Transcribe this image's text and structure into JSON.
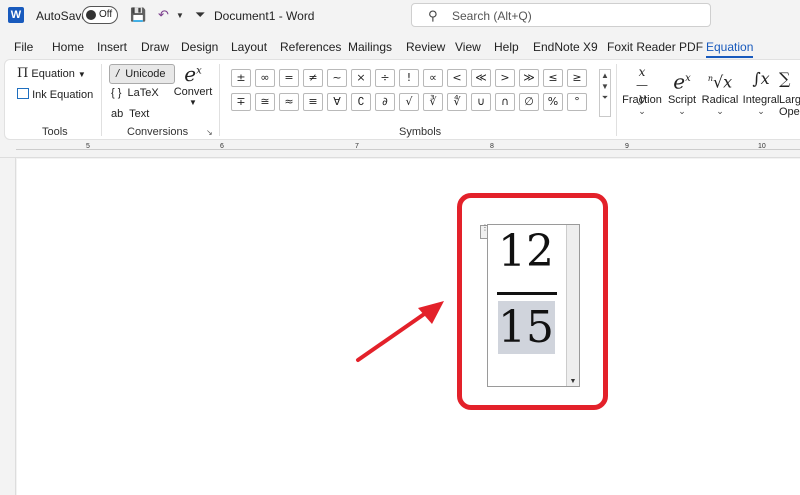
{
  "titlebar": {
    "word_badge": "W",
    "autosave_label": "AutoSave",
    "autosave_state": "Off",
    "doc_title": "Document1  -  Word",
    "search_placeholder": "Search (Alt+Q)"
  },
  "tabs": [
    "File",
    "Home",
    "Insert",
    "Draw",
    "Design",
    "Layout",
    "References",
    "Mailings",
    "Review",
    "View",
    "Help",
    "EndNote X9",
    "Foxit Reader PDF",
    "Equation"
  ],
  "active_tab": "Equation",
  "ribbon": {
    "tools": {
      "equation_label": "Equation",
      "ink_label": "Ink Equation",
      "group_label": "Tools"
    },
    "conversions": {
      "unicode_label": "Unicode",
      "latex_label": "LaTeX",
      "text_label": "Text",
      "convert_label": "Convert",
      "group_label": "Conversions"
    },
    "symbols": {
      "row1": [
        "±",
        "∞",
        "=",
        "≠",
        "~",
        "×",
        "÷",
        "!",
        "∝",
        "<",
        "≪",
        ">",
        "≫",
        "≤",
        "≥"
      ],
      "row2": [
        "∓",
        "≅",
        "≈",
        "≡",
        "∀",
        "∁",
        "∂",
        "√",
        "∛",
        "∜",
        "∪",
        "∩",
        "∅",
        "%",
        "°"
      ],
      "group_label": "Symbols"
    },
    "structures": [
      "Fraction",
      "Script",
      "Radical",
      "Integral",
      "Large Operator"
    ]
  },
  "ruler_numbers": [
    "5",
    "6",
    "7",
    "8",
    "9",
    "10"
  ],
  "equation": {
    "numerator": "12",
    "denominator": "15"
  },
  "colors": {
    "accent": "#185abd",
    "callout": "#e3212a",
    "selection": "#d0d4dc"
  }
}
